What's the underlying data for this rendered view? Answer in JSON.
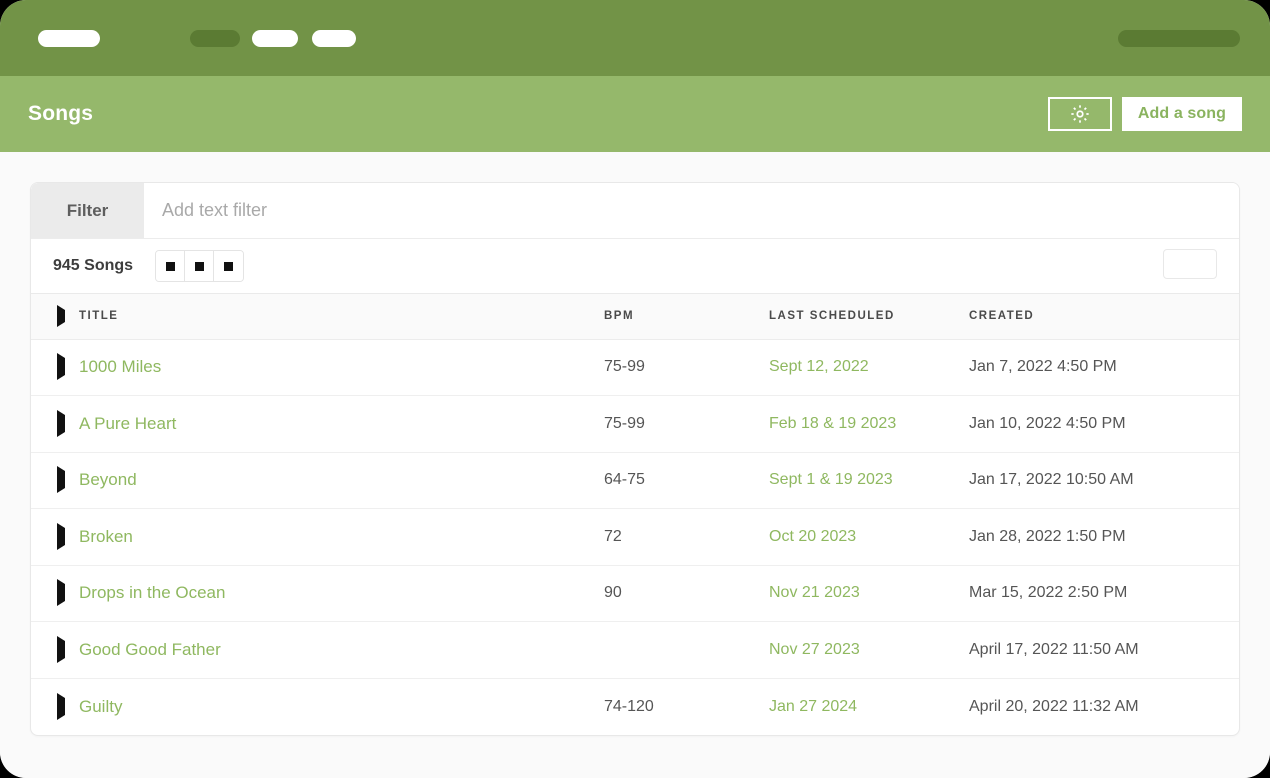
{
  "topnav": {
    "items": [
      {
        "name": "nav-pill-logo",
        "style": "white"
      },
      {
        "name": "nav-pill-item-1",
        "style": "dark"
      },
      {
        "name": "nav-pill-item-2",
        "style": "white"
      },
      {
        "name": "nav-pill-item-3",
        "style": "white"
      },
      {
        "name": "nav-pill-account",
        "style": "dark"
      }
    ],
    "background": "#729347",
    "pill_dark": "#5b7b33"
  },
  "subheader": {
    "title": "Songs",
    "background": "#95b86b",
    "settings_icon": "gear-icon",
    "add_song_label": "Add a song",
    "add_song_text_color": "#8ab35f"
  },
  "filter": {
    "tab_label": "Filter",
    "input_value": "",
    "placeholder": "Add text filter"
  },
  "toolbar": {
    "count_label": "945 Songs",
    "view_buttons": [
      "view-option-1",
      "view-option-2",
      "view-option-3"
    ],
    "right_button_label": ""
  },
  "table": {
    "columns": [
      {
        "key": "arrow",
        "label": ""
      },
      {
        "key": "title",
        "label": "TITLE"
      },
      {
        "key": "ph1",
        "label": ""
      },
      {
        "key": "ph2",
        "label": ""
      },
      {
        "key": "ph3",
        "label": ""
      },
      {
        "key": "ph4",
        "label": ""
      },
      {
        "key": "bpm",
        "label": "BPM"
      },
      {
        "key": "sched",
        "label": "LAST SCHEDULED"
      },
      {
        "key": "created",
        "label": "CREATED"
      }
    ],
    "link_color": "#8fb860",
    "rows": [
      {
        "title": "1000 Miles",
        "bpm": "75-99",
        "last_scheduled": "Sept 12, 2022",
        "created": "Jan 7, 2022 4:50 PM"
      },
      {
        "title": "A Pure Heart",
        "bpm": "75-99",
        "last_scheduled": "Feb 18 & 19 2023",
        "created": "Jan 10, 2022 4:50 PM"
      },
      {
        "title": "Beyond",
        "bpm": "64-75",
        "last_scheduled": "Sept 1 & 19 2023",
        "created": "Jan 17, 2022 10:50 AM"
      },
      {
        "title": "Broken",
        "bpm": "72",
        "last_scheduled": "Oct 20 2023",
        "created": "Jan 28, 2022 1:50 PM"
      },
      {
        "title": "Drops in the Ocean",
        "bpm": "90",
        "last_scheduled": "Nov 21 2023",
        "created": "Mar 15, 2022 2:50 PM"
      },
      {
        "title": "Good Good Father",
        "bpm": "",
        "last_scheduled": "Nov 27 2023",
        "created": "April 17, 2022 11:50 AM"
      },
      {
        "title": "Guilty",
        "bpm": "74-120",
        "last_scheduled": "Jan 27 2024",
        "created": "April 20, 2022 11:32 AM"
      }
    ]
  }
}
